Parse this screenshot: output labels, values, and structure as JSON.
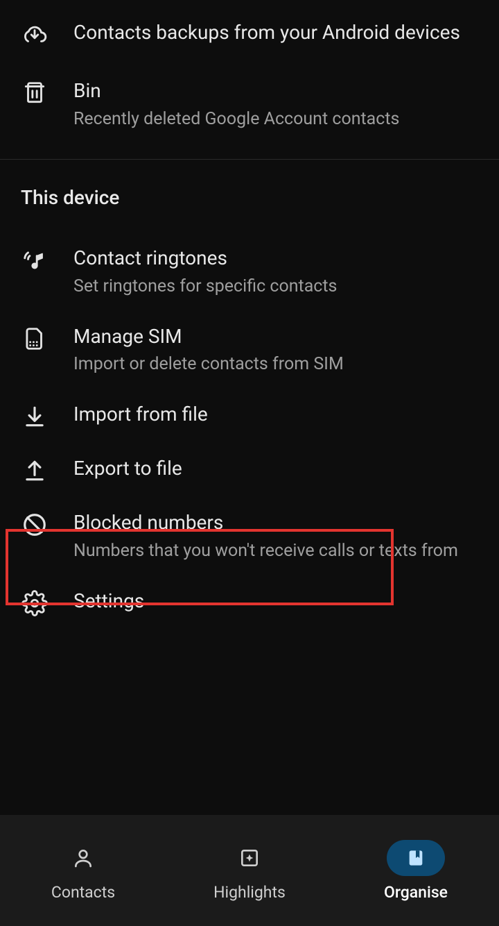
{
  "top_items": [
    {
      "title": "Contacts backups from your Android devices",
      "subtitle": ""
    },
    {
      "title": "Bin",
      "subtitle": "Recently deleted Google Account contacts"
    }
  ],
  "section_header": "This device",
  "device_items": [
    {
      "title": "Contact ringtones",
      "subtitle": "Set ringtones for specific contacts"
    },
    {
      "title": "Manage SIM",
      "subtitle": "Import or delete contacts from SIM"
    },
    {
      "title": "Import from file",
      "subtitle": ""
    },
    {
      "title": "Export to file",
      "subtitle": ""
    },
    {
      "title": "Blocked numbers",
      "subtitle": "Numbers that you won't receive calls or texts from"
    },
    {
      "title": "Settings",
      "subtitle": ""
    }
  ],
  "nav": {
    "contacts": "Contacts",
    "highlights": "Highlights",
    "organise": "Organise"
  },
  "highlighted_item_index": 3
}
